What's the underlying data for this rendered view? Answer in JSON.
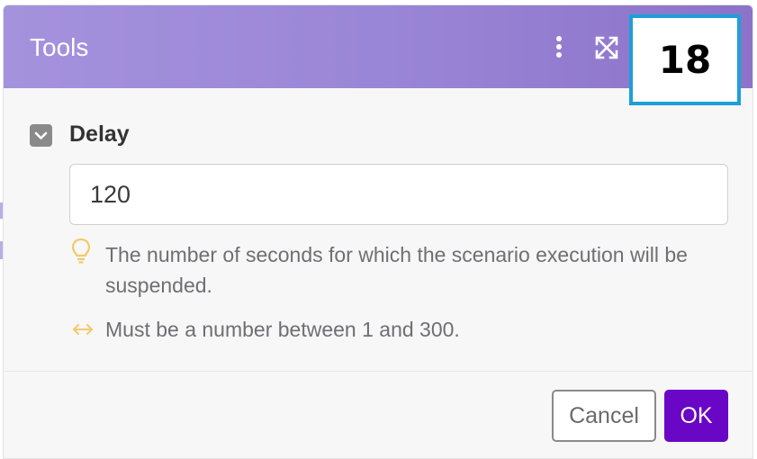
{
  "dialog": {
    "title": "Tools",
    "badge": "18"
  },
  "icons": {
    "menu": "vertical-dots-icon",
    "expand": "expand-arrows-icon",
    "toggle": "chevron-down-icon",
    "hint": "lightbulb-icon",
    "range": "horizontal-arrows-icon"
  },
  "field": {
    "label": "Delay",
    "value": "120",
    "hint": "The number of seconds for which the scenario execution will be suspended.",
    "range_hint": "Must be a number between 1 and 300."
  },
  "footer": {
    "cancel_label": "Cancel",
    "ok_label": "OK"
  },
  "colors": {
    "header_start": "#a592dd",
    "header_end": "#8c73c9",
    "badge_border": "#1d9fd8",
    "primary": "#6a07c6",
    "hint_icon": "#f2c96a"
  }
}
